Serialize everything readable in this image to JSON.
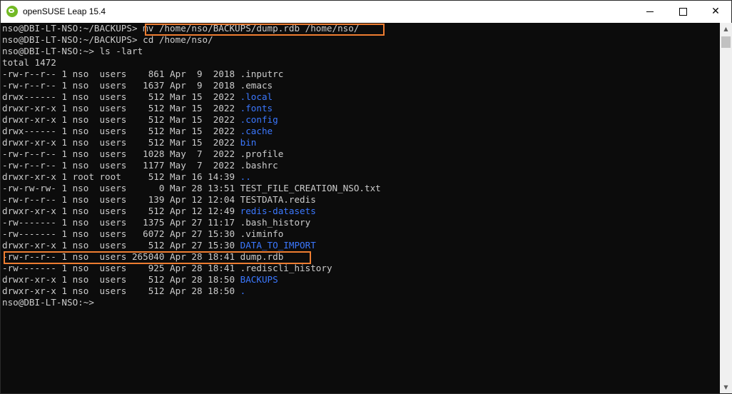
{
  "window": {
    "title": "openSUSE Leap 15.4",
    "accent": "#ee7d31",
    "directory_color": "#3b78ff",
    "text_color": "#cccccc"
  },
  "controls": {
    "minimize": "minimize-icon",
    "maximize": "maximize-icon",
    "close": "✕"
  },
  "terminal": {
    "lines": [
      {
        "prompt": "nso@DBI-LT-NSO:~/BACKUPS>",
        "command": " mv /home/nso/BACKUPS/dump.rdb /home/nso/"
      },
      {
        "prompt": "nso@DBI-LT-NSO:~/BACKUPS>",
        "command": " cd /home/nso/"
      },
      {
        "prompt": "nso@DBI-LT-NSO:~>",
        "command": " ls -lart"
      },
      {
        "text": "total 1472"
      },
      {
        "meta": "-rw-r--r-- 1 nso  users    861 Apr  9  2018 ",
        "name": ".inputrc",
        "dir": false
      },
      {
        "meta": "-rw-r--r-- 1 nso  users   1637 Apr  9  2018 ",
        "name": ".emacs",
        "dir": false
      },
      {
        "meta": "drwx------ 1 nso  users    512 Mar 15  2022 ",
        "name": ".local",
        "dir": true
      },
      {
        "meta": "drwxr-xr-x 1 nso  users    512 Mar 15  2022 ",
        "name": ".fonts",
        "dir": true
      },
      {
        "meta": "drwxr-xr-x 1 nso  users    512 Mar 15  2022 ",
        "name": ".config",
        "dir": true
      },
      {
        "meta": "drwx------ 1 nso  users    512 Mar 15  2022 ",
        "name": ".cache",
        "dir": true
      },
      {
        "meta": "drwxr-xr-x 1 nso  users    512 Mar 15  2022 ",
        "name": "bin",
        "dir": true
      },
      {
        "meta": "-rw-r--r-- 1 nso  users   1028 May  7  2022 ",
        "name": ".profile",
        "dir": false
      },
      {
        "meta": "-rw-r--r-- 1 nso  users   1177 May  7  2022 ",
        "name": ".bashrc",
        "dir": false
      },
      {
        "meta": "drwxr-xr-x 1 root root     512 Mar 16 14:39 ",
        "name": "..",
        "dir": true
      },
      {
        "meta": "-rw-rw-rw- 1 nso  users      0 Mar 28 13:51 ",
        "name": "TEST_FILE_CREATION_NSO.txt",
        "dir": false
      },
      {
        "meta": "-rw-r--r-- 1 nso  users    139 Apr 12 12:04 ",
        "name": "TESTDATA.redis",
        "dir": false
      },
      {
        "meta": "drwxr-xr-x 1 nso  users    512 Apr 12 12:49 ",
        "name": "redis-datasets",
        "dir": true
      },
      {
        "meta": "-rw------- 1 nso  users   1375 Apr 27 11:17 ",
        "name": ".bash_history",
        "dir": false
      },
      {
        "meta": "-rw------- 1 nso  users   6072 Apr 27 15:30 ",
        "name": ".viminfo",
        "dir": false
      },
      {
        "meta": "drwxr-xr-x 1 nso  users    512 Apr 27 15:30 ",
        "name": "DATA_TO_IMPORT",
        "dir": true
      },
      {
        "meta": "-rw-r--r-- 1 nso  users 265040 Apr 28 18:41 ",
        "name": "dump.rdb",
        "dir": false
      },
      {
        "meta": "-rw------- 1 nso  users    925 Apr 28 18:41 ",
        "name": ".rediscli_history",
        "dir": false
      },
      {
        "meta": "drwxr-xr-x 1 nso  users    512 Apr 28 18:50 ",
        "name": "BACKUPS",
        "dir": true
      },
      {
        "meta": "drwxr-xr-x 1 nso  users    512 Apr 28 18:50 ",
        "name": ".",
        "dir": true
      },
      {
        "prompt": "nso@DBI-LT-NSO:~>",
        "command": ""
      }
    ]
  }
}
